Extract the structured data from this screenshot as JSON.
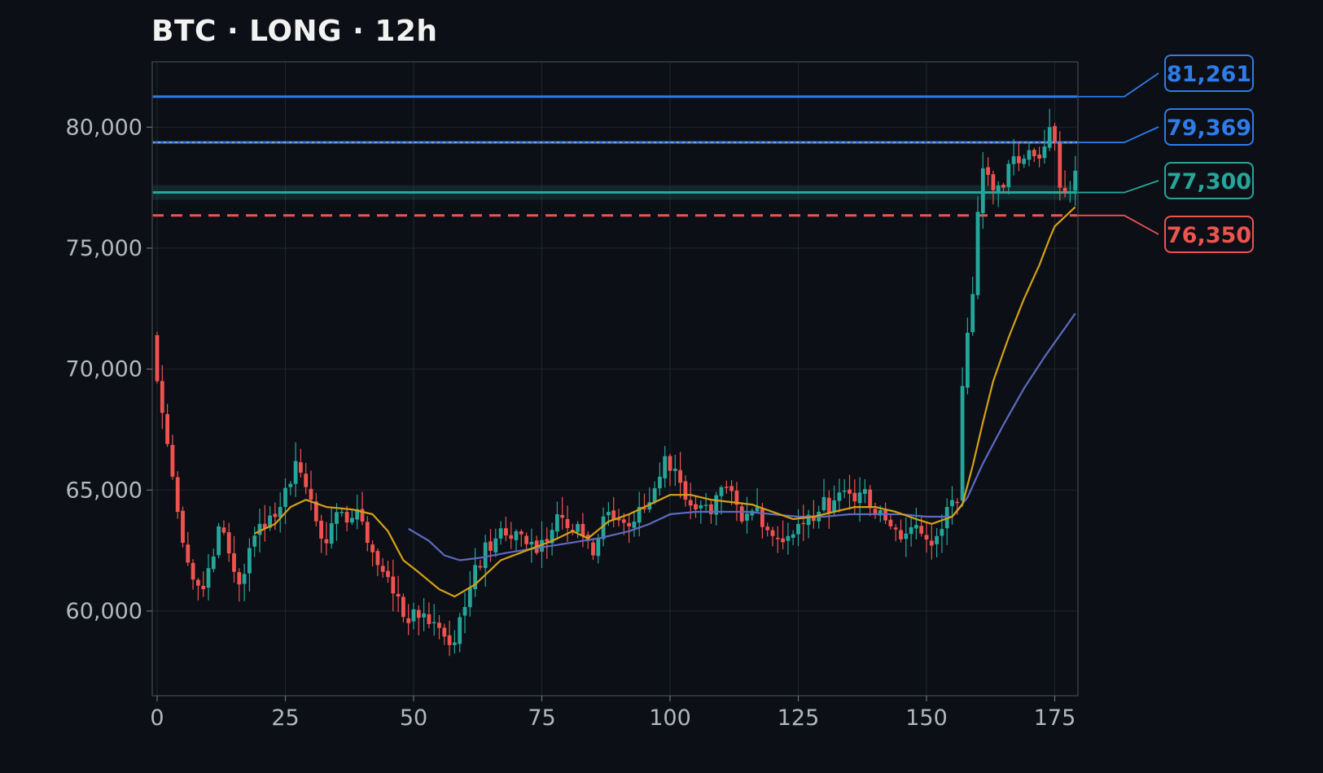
{
  "title": "BTC · LONG · 12h",
  "colors": {
    "background": "#0c0f16",
    "grid": "#1f242c",
    "frame": "#3a3f47",
    "up": "#26a69a",
    "down": "#ef5350",
    "ma_fast": "#d4a017",
    "ma_slow": "#5c6bc0",
    "level_blue": "#2f7be8",
    "level_teal": "#26a69a",
    "level_red": "#ef5350"
  },
  "chart_data": {
    "type": "candlestick",
    "title": "BTC · LONG · 12h",
    "x_ticks": [
      0,
      25,
      50,
      75,
      100,
      125,
      150,
      175
    ],
    "x_tick_labels": [
      "0",
      "25",
      "50",
      "75",
      "100",
      "125",
      "150",
      "175"
    ],
    "y_ticks": [
      60000,
      65000,
      70000,
      75000,
      80000
    ],
    "y_tick_labels": [
      "60,000",
      "65,000",
      "70,000",
      "75,000",
      "80,000"
    ],
    "xlim": [
      -1,
      180
    ],
    "ylim": [
      56500,
      82700
    ],
    "grid": true,
    "candle_close_anchors": [
      [
        0,
        69500
      ],
      [
        2,
        66900
      ],
      [
        4,
        64100
      ],
      [
        7,
        61300
      ],
      [
        9,
        60900
      ],
      [
        12,
        63500
      ],
      [
        16,
        61100
      ],
      [
        20,
        63600
      ],
      [
        24,
        64300
      ],
      [
        27,
        66200
      ],
      [
        30,
        64600
      ],
      [
        33,
        62800
      ],
      [
        36,
        64100
      ],
      [
        40,
        63700
      ],
      [
        43,
        61900
      ],
      [
        47,
        60600
      ],
      [
        49,
        59500
      ],
      [
        52,
        59900
      ],
      [
        55,
        59300
      ],
      [
        58,
        58700
      ],
      [
        62,
        61900
      ],
      [
        66,
        63000
      ],
      [
        70,
        63300
      ],
      [
        74,
        62400
      ],
      [
        78,
        64000
      ],
      [
        82,
        63600
      ],
      [
        85,
        62300
      ],
      [
        88,
        64100
      ],
      [
        92,
        63500
      ],
      [
        96,
        64500
      ],
      [
        99,
        66400
      ],
      [
        102,
        65300
      ],
      [
        105,
        64200
      ],
      [
        108,
        64000
      ],
      [
        111,
        65100
      ],
      [
        114,
        63700
      ],
      [
        117,
        64300
      ],
      [
        120,
        63100
      ],
      [
        123,
        63100
      ],
      [
        126,
        63600
      ],
      [
        129,
        64100
      ],
      [
        133,
        64900
      ],
      [
        137,
        64900
      ],
      [
        140,
        64000
      ],
      [
        143,
        63500
      ],
      [
        146,
        63200
      ],
      [
        149,
        63200
      ],
      [
        152,
        63100
      ],
      [
        154,
        64300
      ],
      [
        156,
        64500
      ],
      [
        157,
        69300
      ],
      [
        158,
        71500
      ],
      [
        159,
        73100
      ],
      [
        160,
        76500
      ],
      [
        161,
        78300
      ],
      [
        163,
        77400
      ],
      [
        165,
        77500
      ],
      [
        167,
        78800
      ],
      [
        169,
        78700
      ],
      [
        171,
        78800
      ],
      [
        173,
        79200
      ],
      [
        174,
        80000
      ],
      [
        175,
        79400
      ],
      [
        176,
        77500
      ],
      [
        177,
        77300
      ],
      [
        179,
        78200
      ]
    ],
    "candle_count": 180,
    "ma_fast": {
      "name": "",
      "start": 19,
      "anchors": [
        [
          19,
          63200
        ],
        [
          23,
          63600
        ],
        [
          26,
          64300
        ],
        [
          29,
          64600
        ],
        [
          33,
          64300
        ],
        [
          38,
          64200
        ],
        [
          42,
          64000
        ],
        [
          45,
          63300
        ],
        [
          48,
          62100
        ],
        [
          51,
          61600
        ],
        [
          55,
          60900
        ],
        [
          58,
          60600
        ],
        [
          62,
          61100
        ],
        [
          67,
          62100
        ],
        [
          72,
          62500
        ],
        [
          77,
          62900
        ],
        [
          81,
          63300
        ],
        [
          84,
          63000
        ],
        [
          88,
          63700
        ],
        [
          92,
          64000
        ],
        [
          96,
          64400
        ],
        [
          100,
          64800
        ],
        [
          104,
          64800
        ],
        [
          108,
          64600
        ],
        [
          112,
          64500
        ],
        [
          116,
          64400
        ],
        [
          120,
          64100
        ],
        [
          124,
          63800
        ],
        [
          128,
          63900
        ],
        [
          132,
          64100
        ],
        [
          136,
          64300
        ],
        [
          140,
          64300
        ],
        [
          144,
          64100
        ],
        [
          148,
          63800
        ],
        [
          151,
          63600
        ],
        [
          155,
          63900
        ],
        [
          157,
          64400
        ],
        [
          159,
          66000
        ],
        [
          161,
          67800
        ],
        [
          163,
          69500
        ],
        [
          166,
          71300
        ],
        [
          169,
          72900
        ],
        [
          172,
          74300
        ],
        [
          174,
          75400
        ],
        [
          175,
          75900
        ],
        [
          177,
          76300
        ],
        [
          179,
          76700
        ]
      ]
    },
    "ma_slow": {
      "name": "",
      "start": 49,
      "anchors": [
        [
          49,
          63400
        ],
        [
          53,
          62900
        ],
        [
          56,
          62300
        ],
        [
          59,
          62100
        ],
        [
          63,
          62200
        ],
        [
          68,
          62400
        ],
        [
          74,
          62600
        ],
        [
          80,
          62800
        ],
        [
          86,
          63000
        ],
        [
          92,
          63300
        ],
        [
          96,
          63600
        ],
        [
          100,
          64000
        ],
        [
          105,
          64100
        ],
        [
          110,
          64100
        ],
        [
          115,
          64100
        ],
        [
          120,
          64000
        ],
        [
          125,
          63900
        ],
        [
          130,
          63900
        ],
        [
          135,
          64000
        ],
        [
          140,
          64000
        ],
        [
          145,
          64000
        ],
        [
          150,
          63900
        ],
        [
          155,
          63900
        ],
        [
          158,
          64700
        ],
        [
          161,
          66100
        ],
        [
          165,
          67700
        ],
        [
          169,
          69200
        ],
        [
          173,
          70500
        ],
        [
          176,
          71400
        ],
        [
          179,
          72300
        ]
      ]
    },
    "levels": [
      {
        "value": 81261,
        "label": "81,261",
        "style": "solid",
        "color_key": "level_blue"
      },
      {
        "value": 79369,
        "label": "79,369",
        "style": "solid-dotted",
        "color_key": "level_blue"
      },
      {
        "value": 77300,
        "label": "77,300",
        "style": "solid-band",
        "color_key": "level_teal"
      },
      {
        "value": 76350,
        "label": "76,350",
        "style": "dashed",
        "color_key": "level_red"
      }
    ]
  }
}
